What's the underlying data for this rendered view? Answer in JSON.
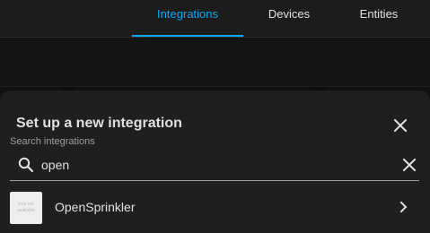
{
  "tabs": [
    {
      "label": "Integrations",
      "active": true
    },
    {
      "label": "Devices",
      "active": false
    },
    {
      "label": "Entities",
      "active": false
    }
  ],
  "dialog": {
    "title": "Set up a new integration",
    "search_label": "Search integrations",
    "search_value": "open",
    "results": [
      {
        "label": "OpenSprinkler",
        "icon_placeholder": "icon not available"
      }
    ]
  },
  "icons": {
    "close": "close-icon",
    "search": "magnify-icon",
    "clear": "clear-icon",
    "chevron": "chevron-right-icon"
  },
  "colors": {
    "accent": "#03a9f4",
    "text": "#e1e1e1",
    "secondary_text": "#9e9e9e",
    "dialog_bg": "#1f1f1f"
  }
}
